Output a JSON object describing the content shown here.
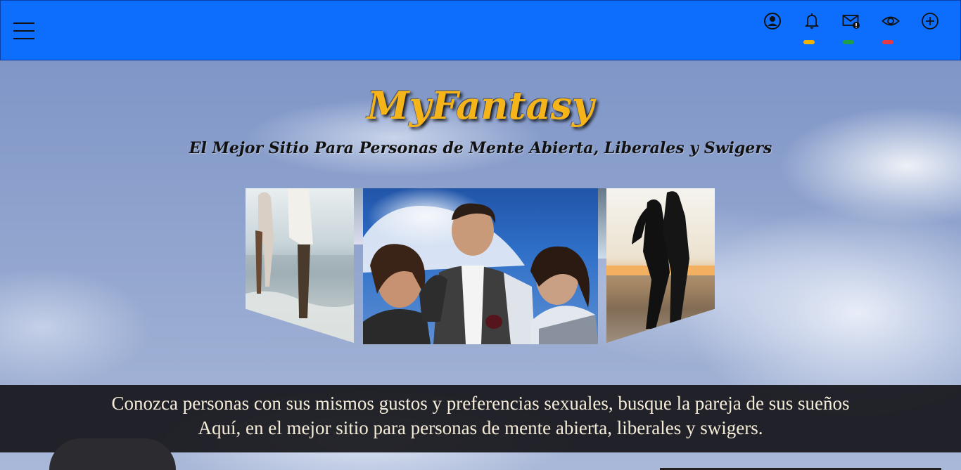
{
  "navbar": {
    "menu_label": "menu",
    "icons": [
      {
        "name": "account-icon",
        "dot": null
      },
      {
        "name": "bell-icon",
        "dot": "#f0b400"
      },
      {
        "name": "mail-alert-icon",
        "dot": "#1f9d4c"
      },
      {
        "name": "eye-icon",
        "dot": "#e53945"
      },
      {
        "name": "plus-circle-icon",
        "dot": null
      }
    ],
    "background": "#0d6efd"
  },
  "hero": {
    "brand": "MyFantasy",
    "tagline": "El Mejor Sitio Para Personas de Mente Abierta, Liberales y Swigers",
    "brand_color": "#f4b41a"
  },
  "gallery": {
    "images": [
      {
        "name": "couple-walking-beach-photo"
      },
      {
        "name": "man-with-two-women-photo"
      },
      {
        "name": "couple-silhouette-sunset-photo"
      }
    ]
  },
  "banner": {
    "line1": "Conozca personas con sus mismos gustos y preferencias sexuales, busque la pareja de sus sueños",
    "line2": "Aquí, en el mejor sitio para personas de mente abierta, liberales y swigers."
  }
}
